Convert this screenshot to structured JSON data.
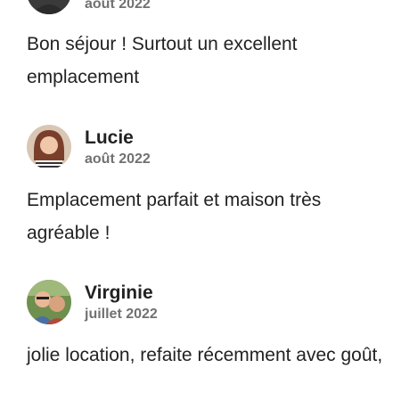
{
  "reviews": [
    {
      "name": "",
      "date": "août 2022",
      "text": "Bon séjour ! Surtout un excellent emplacement"
    },
    {
      "name": "Lucie",
      "date": "août 2022",
      "text": "Emplacement parfait et maison très agréable !"
    },
    {
      "name": "Virginie",
      "date": "juillet 2022",
      "text": "jolie location, refaite récemment avec goût,"
    }
  ]
}
